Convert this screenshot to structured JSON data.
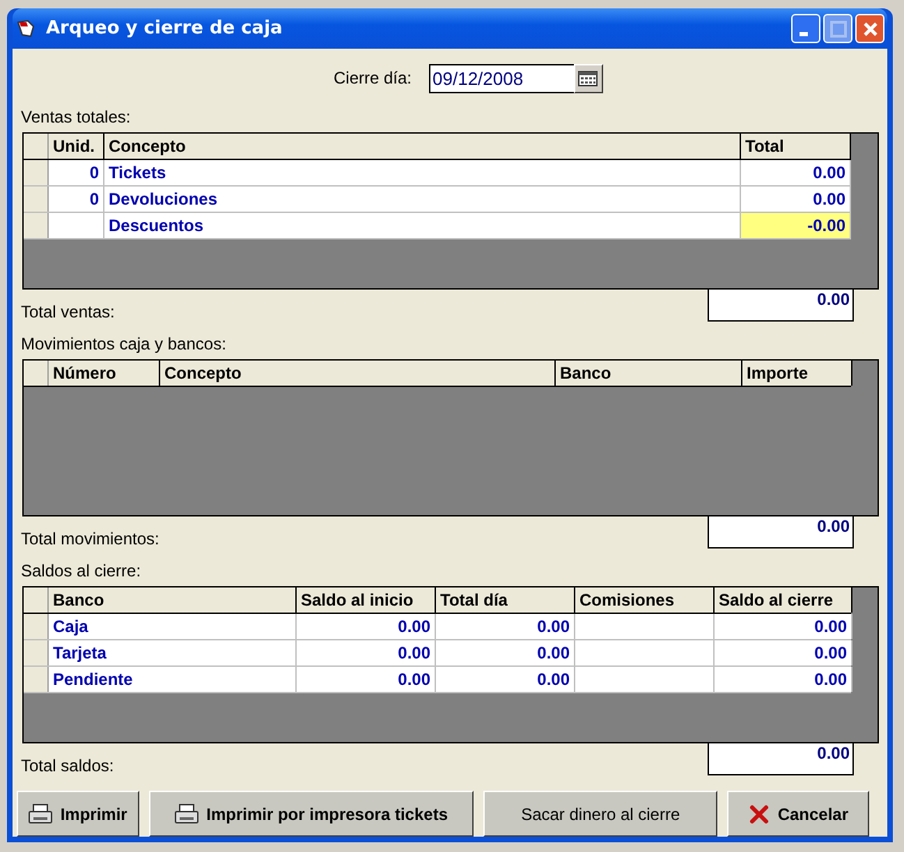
{
  "window": {
    "title": "Arqueo y cierre de caja"
  },
  "date_field": {
    "label": "Cierre día:",
    "value": "09/12/2008"
  },
  "sections": [
    {
      "label": "Ventas totales:",
      "total_label": "Total ventas:",
      "total_value": "0.00",
      "columns": [
        "Unid.",
        "Concepto",
        "Total"
      ],
      "rows": [
        {
          "cells": [
            "0",
            "Tickets",
            "0.00"
          ],
          "highlighted": false
        },
        {
          "cells": [
            "0",
            "Devoluciones",
            "0.00"
          ],
          "highlighted": false
        },
        {
          "cells": [
            "",
            "Descuentos",
            "-0.00"
          ],
          "highlighted": true
        }
      ]
    },
    {
      "label": "Movimientos caja y bancos:",
      "total_label": "Total movimientos:",
      "total_value": "0.00",
      "columns": [
        "Número",
        "Concepto",
        "Banco",
        "Importe"
      ]
    },
    {
      "label": "Saldos al cierre:",
      "total_label": "Total saldos:",
      "total_value": "0.00",
      "columns": [
        "Banco",
        "Saldo al inicio",
        "Total día",
        "Comisiones",
        "Saldo al cierre"
      ],
      "rows": [
        {
          "cells": [
            "Caja",
            "0.00",
            "0.00",
            "",
            "0.00"
          ],
          "highlighted": false
        },
        {
          "cells": [
            "Tarjeta",
            "0.00",
            "0.00",
            "",
            "0.00"
          ],
          "highlighted": false
        },
        {
          "cells": [
            "Pendiente",
            "0.00",
            "0.00",
            "",
            "0.00"
          ],
          "highlighted": false
        }
      ]
    }
  ],
  "buttons": [
    {
      "label": "Imprimir",
      "kind": "print"
    },
    {
      "label": "Imprimir por impresora tickets",
      "kind": "print"
    },
    {
      "label": "Sacar dinero al cierre",
      "kind": "plain"
    },
    {
      "label": "Cancelar",
      "kind": "cancel"
    }
  ]
}
